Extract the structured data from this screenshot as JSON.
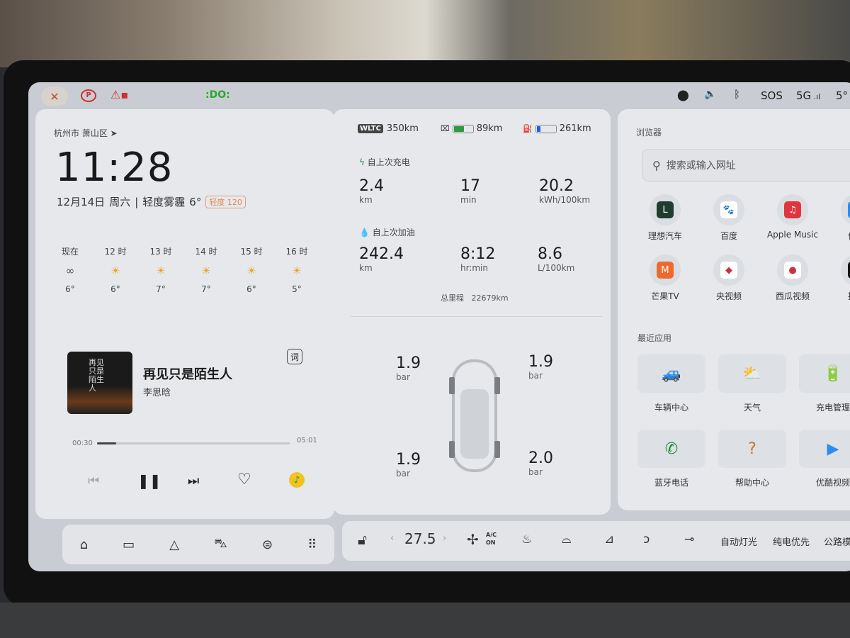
{
  "status_bar": {
    "left_icons": [
      "wrench-icon",
      "parking-brake-icon",
      "seatbelt-warning-icon",
      "headlight-icon"
    ],
    "right_icons": [
      "location-icon",
      "volume-icon",
      "bluetooth-icon"
    ],
    "sos": "SOS",
    "network": "5G",
    "temperature": "5°"
  },
  "weather_card": {
    "location": "杭州市 萧山区",
    "time": "11:28",
    "date": "12月14日",
    "weekday": "周六",
    "condition": "轻度雾霾",
    "temp": "6°",
    "aqi_badge": "轻度 120",
    "forecast": [
      {
        "label": "现在",
        "icon": "haze-icon",
        "temp": "6°"
      },
      {
        "label": "12 时",
        "icon": "sun-icon",
        "temp": "6°"
      },
      {
        "label": "13 时",
        "icon": "sun-icon",
        "temp": "7°"
      },
      {
        "label": "14 时",
        "icon": "sun-icon",
        "temp": "7°"
      },
      {
        "label": "15 时",
        "icon": "sun-icon",
        "temp": "6°"
      },
      {
        "label": "16 时",
        "icon": "sun-icon",
        "temp": "5°"
      }
    ]
  },
  "music": {
    "title": "再见只是陌生人",
    "artist": "李思晗",
    "lyrics_button": "词",
    "elapsed": "00:30",
    "duration": "05:01",
    "progress": 0.1,
    "album_text": "再见只是陌生人"
  },
  "vehicle": {
    "wltc_badge": "WLTC",
    "wltc_range": "350km",
    "electric_range": "89km",
    "electric_level": 0.55,
    "fuel_range": "261km",
    "fuel_level": 0.2,
    "since_charge": {
      "label": "自上次充电",
      "stats": [
        {
          "value": "2.4",
          "unit": "km"
        },
        {
          "value": "17",
          "unit": "min"
        },
        {
          "value": "20.2",
          "unit": "kWh/100km"
        }
      ]
    },
    "since_refuel": {
      "label": "自上次加油",
      "stats": [
        {
          "value": "242.4",
          "unit": "km"
        },
        {
          "value": "8:12",
          "unit": "hr:min"
        },
        {
          "value": "8.6",
          "unit": "L/100km"
        }
      ]
    },
    "odometer_label": "总里程",
    "odometer": "22679km",
    "tires": {
      "front_left": {
        "value": "1.9",
        "unit": "bar"
      },
      "front_right": {
        "value": "1.9",
        "unit": "bar"
      },
      "rear_left": {
        "value": "1.9",
        "unit": "bar"
      },
      "rear_right": {
        "value": "2.0",
        "unit": "bar"
      }
    }
  },
  "browser": {
    "title": "浏览器",
    "search_placeholder": "搜索或输入网址",
    "apps": [
      {
        "label": "理想汽车",
        "color": "#1f3d2e",
        "glyph": "L"
      },
      {
        "label": "百度",
        "color": "#ffffff",
        "glyph": "🐾"
      },
      {
        "label": "Apple Music",
        "color": "#e0343f",
        "glyph": "♫"
      },
      {
        "label": "优酷",
        "color": "#2e8bf0",
        "glyph": "Y"
      },
      {
        "label": "芒果TV",
        "color": "#ee6a2c",
        "glyph": "M"
      },
      {
        "label": "央视频",
        "color": "#ffffff",
        "glyph": "◆"
      },
      {
        "label": "西瓜视频",
        "color": "#ffffff",
        "glyph": "●"
      },
      {
        "label": "抖音",
        "color": "#111111",
        "glyph": "♪"
      }
    ]
  },
  "recent_apps": {
    "title": "最近应用",
    "items": [
      {
        "label": "车辆中心",
        "icon": "car-icon"
      },
      {
        "label": "天气",
        "icon": "weather-icon"
      },
      {
        "label": "充电管理",
        "icon": "battery-icon"
      },
      {
        "label": "蓝牙电话",
        "icon": "phone-icon"
      },
      {
        "label": "帮助中心",
        "icon": "help-icon"
      },
      {
        "label": "优酷视频",
        "icon": "youku-icon"
      }
    ]
  },
  "dock": {
    "left_icons": [
      "home-icon",
      "camera-icon",
      "navigation-icon",
      "car-icon",
      "toggle-icon",
      "apps-grid-icon"
    ],
    "climate_temp": "27.5",
    "ac_label_top": "A/C",
    "ac_label_bottom": "ON",
    "shortcuts": [
      "自动灯光",
      "纯电优先",
      "公路模"
    ]
  }
}
